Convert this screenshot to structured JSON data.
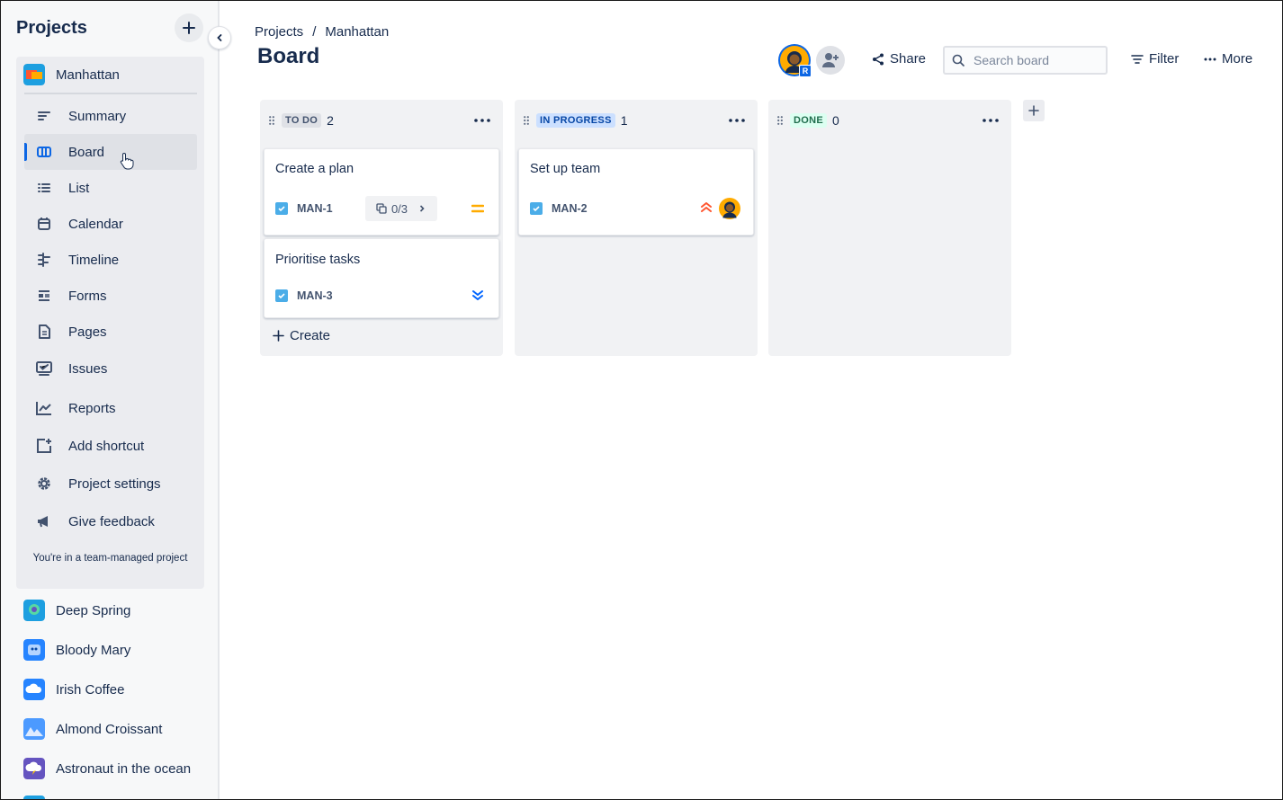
{
  "sidebar": {
    "title": "Projects",
    "current_project": {
      "name": "Manhattan",
      "nav": [
        {
          "label": "Summary",
          "icon": "summary-icon"
        },
        {
          "label": "Board",
          "icon": "board-icon",
          "active": true
        },
        {
          "label": "List",
          "icon": "list-icon"
        },
        {
          "label": "Calendar",
          "icon": "calendar-icon"
        },
        {
          "label": "Timeline",
          "icon": "timeline-icon"
        },
        {
          "label": "Forms",
          "icon": "forms-icon"
        },
        {
          "label": "Pages",
          "icon": "pages-icon"
        },
        {
          "label": "Issues",
          "icon": "issues-icon"
        },
        {
          "label": "Reports",
          "icon": "reports-icon"
        },
        {
          "label": "Add shortcut",
          "icon": "add-shortcut-icon"
        },
        {
          "label": "Project settings",
          "icon": "gear-icon"
        },
        {
          "label": "Give feedback",
          "icon": "megaphone-icon"
        }
      ],
      "team_note": "You're in a team-managed project"
    },
    "other_projects": [
      {
        "name": "Deep Spring",
        "color": "#1d9fe0"
      },
      {
        "name": "Bloody Mary",
        "color": "#2684ff"
      },
      {
        "name": "Irish Coffee",
        "color": "#2684ff"
      },
      {
        "name": "Almond Croissant",
        "color": "#2684ff"
      },
      {
        "name": "Astronaut in the ocean",
        "color": "#6554c0"
      }
    ]
  },
  "breadcrumb": {
    "root": "Projects",
    "separator": "/",
    "current": "Manhattan"
  },
  "page_title": "Board",
  "toolbar": {
    "avatar_badge": "R",
    "share_label": "Share",
    "search_placeholder": "Search board",
    "filter_label": "Filter",
    "more_label": "More"
  },
  "columns": [
    {
      "name": "TO DO",
      "count": "2",
      "lozenge_bg": "#dfe1e6",
      "lozenge_fg": "#42526e",
      "cards": [
        {
          "title": "Create a plan",
          "key": "MAN-1",
          "subtasks": "0/3",
          "priority": "medium"
        },
        {
          "title": "Prioritise tasks",
          "key": "MAN-3",
          "priority": "lowest"
        }
      ],
      "create_label": "Create"
    },
    {
      "name": "IN PROGRESS",
      "count": "1",
      "lozenge_bg": "#cce0ff",
      "lozenge_fg": "#0747a6",
      "cards": [
        {
          "title": "Set up team",
          "key": "MAN-2",
          "priority": "high"
        }
      ]
    },
    {
      "name": "DONE",
      "count": "0",
      "lozenge_bg": "#dcfff1",
      "lozenge_fg": "#216e4e",
      "cards": []
    }
  ],
  "colors": {
    "accent": "#0c66e4",
    "sidebar_bg": "#f7f8f9",
    "column_bg": "#f1f2f4"
  }
}
